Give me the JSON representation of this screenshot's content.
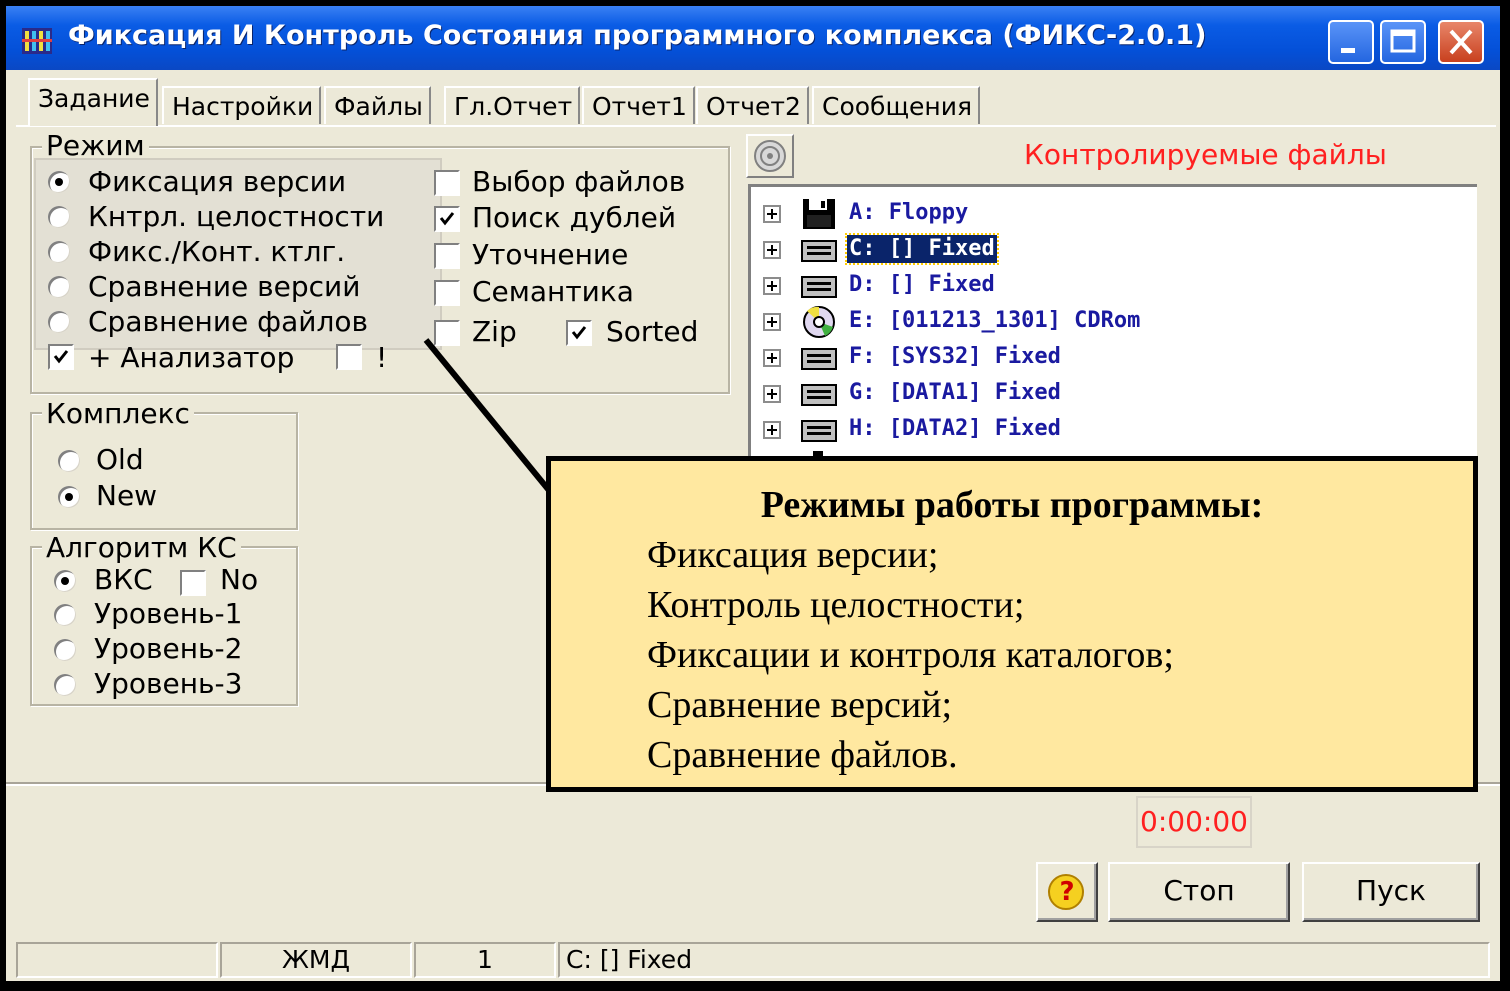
{
  "window": {
    "title": "Фиксация И Контроль Состояния программного комплекса (ФИКС-2.0.1)"
  },
  "tabs": [
    "Задание",
    "Настройки",
    "Файлы",
    "Гл.Отчет",
    "Отчет1",
    "Отчет2",
    "Сообщения"
  ],
  "mode": {
    "legend": "Режим",
    "radios": [
      {
        "label": "Фиксация версии",
        "checked": true
      },
      {
        "label": "Кнтрл. целостности",
        "checked": false
      },
      {
        "label": "Фикс./Конт. ктлг.",
        "checked": false
      },
      {
        "label": "Сравнение версий",
        "checked": false
      },
      {
        "label": "Сравнение  файлов",
        "checked": false
      }
    ],
    "checks": [
      {
        "label": "Выбор файлов",
        "checked": false
      },
      {
        "label": "Поиск дублей",
        "checked": true
      },
      {
        "label": "Уточнение",
        "checked": false
      },
      {
        "label": "Семантика",
        "checked": false
      },
      {
        "label": "Zip",
        "checked": false
      },
      {
        "label": "Sorted",
        "checked": true
      }
    ],
    "analyzer": {
      "label": "+ Анализатор",
      "checked": true
    },
    "bang": {
      "label": "!",
      "checked": false
    }
  },
  "complex": {
    "legend": "Комплекс",
    "radios": [
      {
        "label": "Old",
        "checked": false
      },
      {
        "label": "New",
        "checked": true
      }
    ]
  },
  "algorithm": {
    "legend": "Алгоритм КС",
    "radios": [
      {
        "label": "ВКС",
        "checked": true
      },
      {
        "label": "Уровень-1",
        "checked": false
      },
      {
        "label": "Уровень-2",
        "checked": false
      },
      {
        "label": "Уровень-3",
        "checked": false
      }
    ],
    "no": {
      "label": "No",
      "checked": false
    }
  },
  "tree": {
    "title": "Контролируемые файлы",
    "nodes": [
      {
        "label": "A:  Floppy",
        "icon": "floppy-icon"
      },
      {
        "label": "C: [] Fixed",
        "icon": "hard-drive-icon",
        "selected": true
      },
      {
        "label": "D: [] Fixed",
        "icon": "hard-drive-icon"
      },
      {
        "label": "E: [011213_1301] CDRom",
        "icon": "cd-rom-icon"
      },
      {
        "label": "F: [SYS32] Fixed",
        "icon": "hard-drive-icon"
      },
      {
        "label": "G: [DATA1] Fixed",
        "icon": "hard-drive-icon"
      },
      {
        "label": "H: [DATA2] Fixed",
        "icon": "hard-drive-icon"
      }
    ]
  },
  "timer": "0:00:00",
  "buttons": {
    "help": "?",
    "stop": "Стоп",
    "start": "Пуск"
  },
  "statusbar": [
    "",
    "ЖМД",
    "1",
    "C: [] Fixed"
  ],
  "callout": {
    "title": "Режимы работы программы:",
    "lines": [
      "Фиксация версии;",
      "Контроль целостности;",
      "Фиксации и контроля каталогов;",
      "Сравнение версий;",
      "Сравнение файлов."
    ]
  },
  "colors": {
    "titlebar": "#0a5ce5",
    "window_bg": "#ece9d8",
    "tree_title": "#ff2020",
    "tree_text": "#1a1aa0",
    "callout_bg": "#ffe8a0"
  }
}
